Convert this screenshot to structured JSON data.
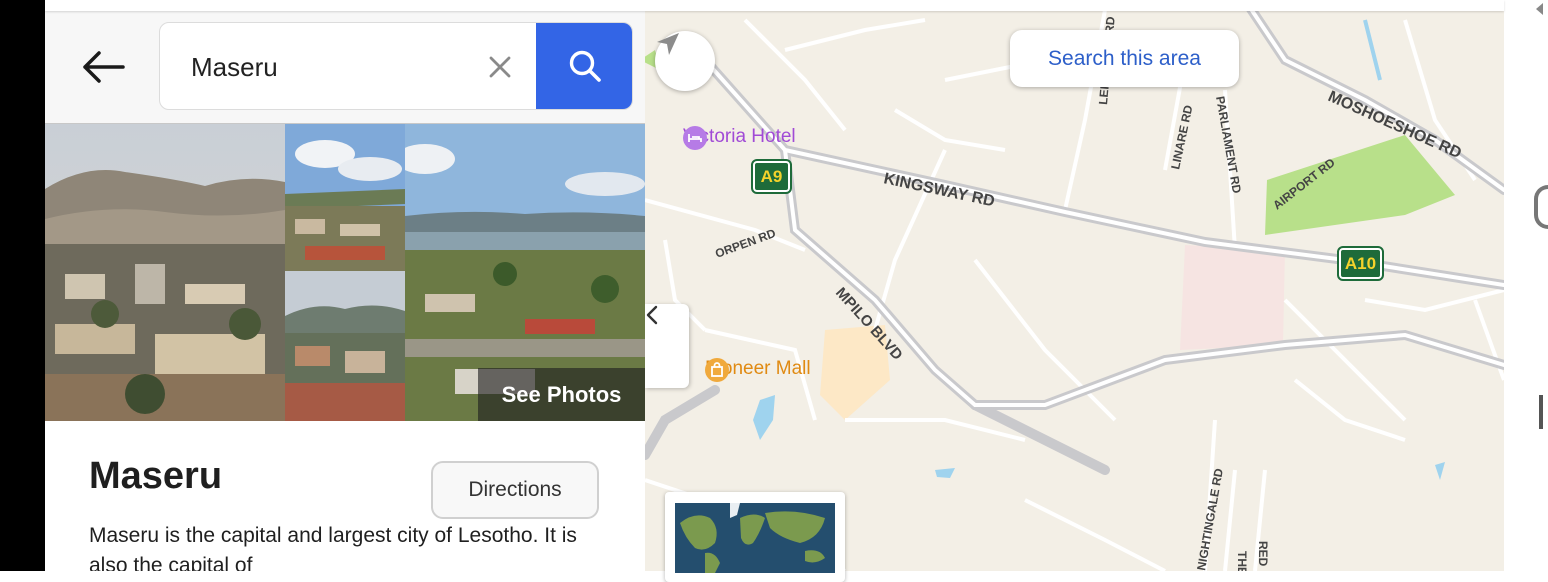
{
  "search": {
    "value": "Maseru",
    "clear_glyph": "✕"
  },
  "photos": {
    "see_photos_label": "See Photos"
  },
  "place": {
    "title": "Maseru",
    "directions_label": "Directions",
    "description": "Maseru is the capital and largest city of Lesotho. It is also the capital of"
  },
  "map": {
    "search_area_label": "Search this area",
    "collapse_glyph": "‹",
    "shields": [
      {
        "label": "A9"
      },
      {
        "label": "A10"
      }
    ],
    "pois": [
      {
        "label": "Victoria Hotel",
        "color": "#a14bd6",
        "icon": "bed-icon"
      },
      {
        "label": "Pioneer Mall",
        "color": "#e08a12",
        "icon": "shopping-bag-icon"
      }
    ],
    "roads": [
      "KINGSWAY RD",
      "MPILO BLVD",
      "ORPEN RD",
      "MOSHOESHOE RD",
      "AIRPORT RD",
      "LINARE RD",
      "PARLIAMENT RD",
      "LERATHOLI RD",
      "NIGHTINGALE RD",
      "THE",
      "RED"
    ]
  },
  "colors": {
    "accent": "#3365e6",
    "link": "#2d5fc9",
    "map_land": "#f3efe6",
    "park": "#b8e08a",
    "shield_bg": "#1e6b3a",
    "shield_text": "#f5d22b"
  }
}
